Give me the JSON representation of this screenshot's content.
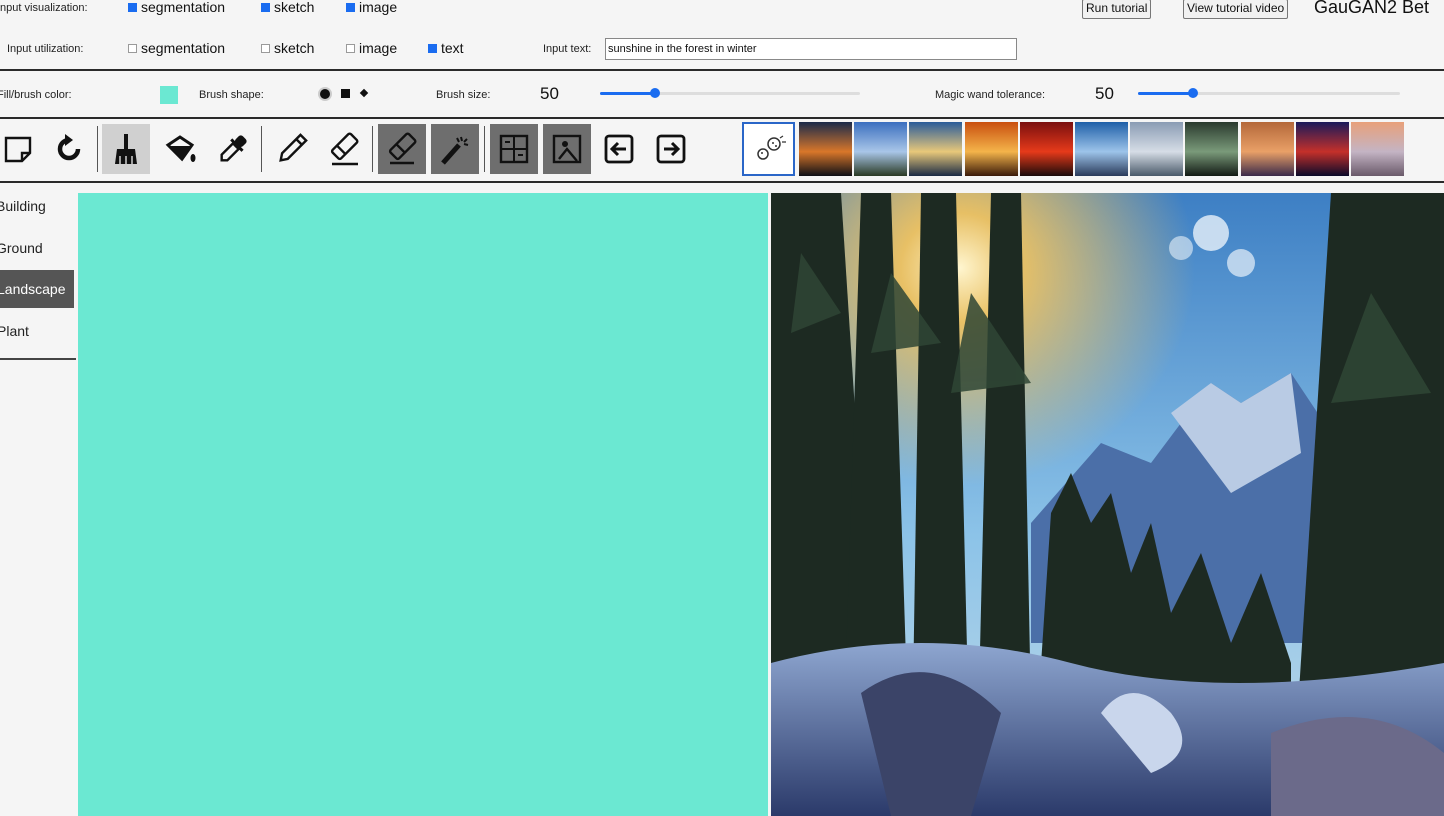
{
  "app": {
    "title": "GauGAN2 Bet"
  },
  "header": {
    "input_visualization": {
      "label": "Input visualization:",
      "options": [
        {
          "label": "segmentation",
          "checked": true
        },
        {
          "label": "sketch",
          "checked": true
        },
        {
          "label": "image",
          "checked": true
        }
      ]
    },
    "input_utilization": {
      "label": "Input utilization:",
      "options": [
        {
          "label": "segmentation",
          "checked": false
        },
        {
          "label": "sketch",
          "checked": false
        },
        {
          "label": "image",
          "checked": false
        },
        {
          "label": "text",
          "checked": true
        }
      ]
    },
    "input_text": {
      "label": "Input text:",
      "value": "sunshine in the forest in winter"
    },
    "run_tutorial": "Run tutorial",
    "view_tutorial_video": "View tutorial video"
  },
  "brush_bar": {
    "fill_color_label": "Fill/brush color:",
    "fill_color": "#6be8d2",
    "brush_shape_label": "Brush shape:",
    "brush_size_label": "Brush size:",
    "brush_size_value": "50",
    "brush_size_fraction": 0.21,
    "magic_wand_label": "Magic wand tolerance:",
    "magic_wand_value": "50",
    "magic_wand_fraction": 0.21
  },
  "toolbar": {
    "tools": [
      {
        "name": "new-canvas-icon"
      },
      {
        "name": "refresh-icon"
      },
      {
        "name": "brush-icon",
        "active": true
      },
      {
        "name": "paint-bucket-icon"
      },
      {
        "name": "eyedropper-icon"
      },
      {
        "name": "pencil-icon"
      },
      {
        "name": "sketch-eraser-icon"
      },
      {
        "name": "eraser-icon"
      },
      {
        "name": "magic-wand-icon"
      },
      {
        "name": "segmentation-grid-icon"
      },
      {
        "name": "image-select-icon"
      },
      {
        "name": "arrow-left-icon"
      },
      {
        "name": "arrow-right-icon"
      },
      {
        "name": "dice-icon"
      }
    ],
    "thumbnails": [
      {
        "name": "thumb-1",
        "colors": [
          "#1a2a4a",
          "#d9772a",
          "#0d0f16"
        ]
      },
      {
        "name": "thumb-2",
        "colors": [
          "#3b6fbf",
          "#a9c6e8",
          "#2a3a24"
        ]
      },
      {
        "name": "thumb-3",
        "colors": [
          "#2a5c9a",
          "#e8c87a",
          "#1a2a44"
        ]
      },
      {
        "name": "thumb-4",
        "colors": [
          "#c94f0f",
          "#f4b44a",
          "#3a1a0a"
        ]
      },
      {
        "name": "thumb-5",
        "colors": [
          "#7a0f0f",
          "#e63a1a",
          "#1a0a0a"
        ]
      },
      {
        "name": "thumb-6",
        "colors": [
          "#1e5fa8",
          "#9dc4ea",
          "#2a3a5a"
        ]
      },
      {
        "name": "thumb-7",
        "colors": [
          "#8a9cb4",
          "#d6dde6",
          "#4a5a6a"
        ]
      },
      {
        "name": "thumb-8",
        "colors": [
          "#2a3a2e",
          "#7a9a7a",
          "#121a14"
        ]
      },
      {
        "name": "thumb-9",
        "colors": [
          "#b4683a",
          "#e9a067",
          "#3a2a4a"
        ]
      },
      {
        "name": "thumb-10",
        "colors": [
          "#1a1a5a",
          "#c4302a",
          "#0a0a2a"
        ]
      },
      {
        "name": "thumb-11",
        "colors": [
          "#e8a07a",
          "#c4b4c4",
          "#6a5a6a"
        ]
      }
    ]
  },
  "sidebar": {
    "items": [
      {
        "label": "Building",
        "selected": false
      },
      {
        "label": "Ground",
        "selected": false
      },
      {
        "label": "Landscape",
        "selected": true
      },
      {
        "label": "Plant",
        "selected": false
      }
    ]
  },
  "canvas": {
    "fill": "#6be8d2"
  }
}
